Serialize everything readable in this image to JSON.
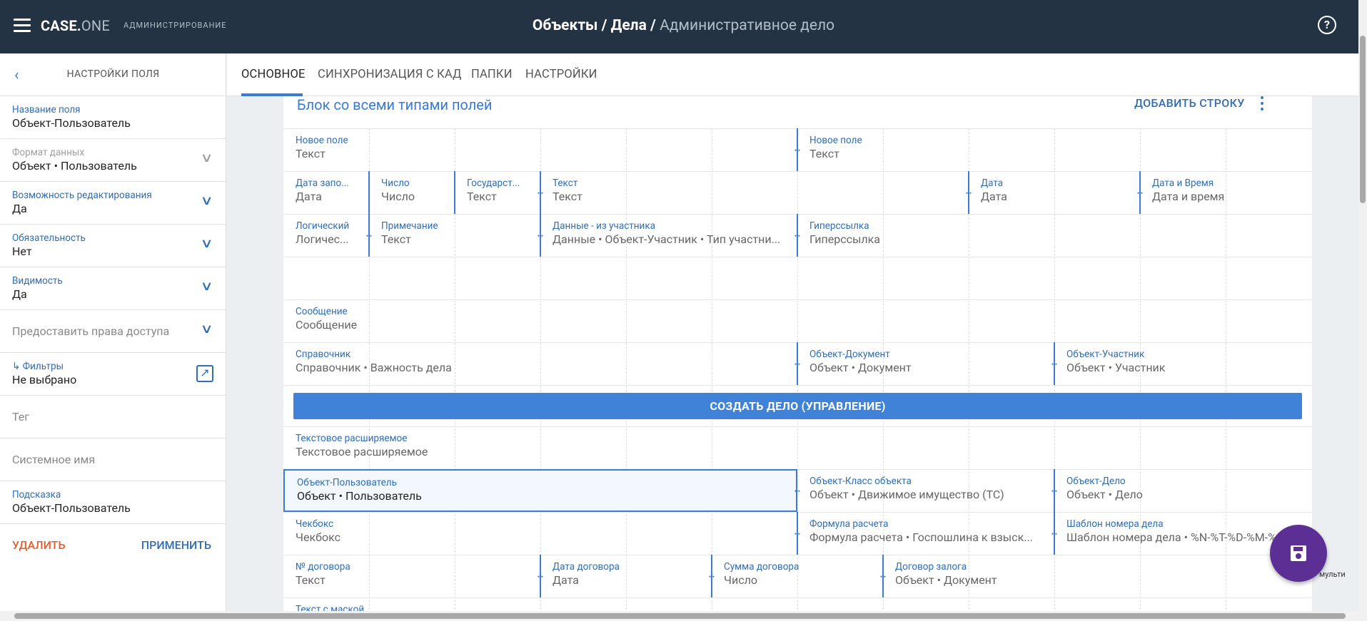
{
  "app": {
    "logo_main": "CASE.",
    "logo_suffix": "ONE",
    "section": "АДМИНИСТРИРОВАНИЕ",
    "breadcrumb": {
      "part1": "Объекты",
      "sep": "/",
      "part2": "Дела",
      "current": "Административное дело"
    },
    "help": "?"
  },
  "sidebar": {
    "title": "НАСТРОЙКИ ПОЛЯ",
    "props": [
      {
        "label": "Название поля",
        "value": "Объект-Пользователь"
      },
      {
        "label": "Формат данных",
        "value": "Объект • Пользователь"
      },
      {
        "label": "Возможность редактирования",
        "value": "Да"
      },
      {
        "label": "Обязательность",
        "value": "Нет"
      },
      {
        "label": "Видимость",
        "value": "Да"
      },
      {
        "label": "Предоставить права доступа"
      },
      {
        "label": "Фильтры",
        "value": "Не выбрано",
        "prefix": "↳"
      },
      {
        "label": "Тег"
      },
      {
        "label": "Системное имя"
      },
      {
        "label": "Подсказка",
        "value": "Объект-Пользователь"
      }
    ],
    "delete": "УДАЛИТЬ",
    "apply": "ПРИМЕНИТЬ"
  },
  "tabs": [
    "ОСНОВНОЕ",
    "СИНХРОНИЗАЦИЯ С КАД",
    "ПАПКИ",
    "НАСТРОЙКИ"
  ],
  "block": {
    "title": "Блок со всеми типами полей",
    "add_row": "ДОБАВИТЬ СТРОКУ",
    "fields": [
      {
        "label": "Новое поле",
        "value": "Текст"
      },
      {
        "label": "Новое поле",
        "value": "Текст"
      },
      {
        "label": "Дата запо...",
        "value": "Дата"
      },
      {
        "label": "Число",
        "value": "Число"
      },
      {
        "label": "Государст...",
        "value": "Текст"
      },
      {
        "label": "Текст",
        "value": "Текст"
      },
      {
        "label": "Дата",
        "value": "Дата"
      },
      {
        "label": "Дата и Время",
        "value": "Дата и время"
      },
      {
        "label": "Логический",
        "value": "Логичес..."
      },
      {
        "label": "Примечание",
        "value": "Текст"
      },
      {
        "label": "Данные - из участника",
        "value": "Данные • Объект-Участник • Тип участни..."
      },
      {
        "label": "Гиперссылка",
        "value": "Гиперссылка"
      },
      {
        "label": "Сообщение",
        "value": "Сообщение"
      },
      {
        "label": "Справочник",
        "value": "Справочник • Важность дела"
      },
      {
        "label": "Объект-Документ",
        "value": "Объект • Документ"
      },
      {
        "label": "Объект-Участник",
        "value": "Объект • Участник"
      },
      {
        "label": "Текстовое расширяемое",
        "value": "Текстовое расширяемое"
      },
      {
        "label": "Объект-Пользователь",
        "value": "Объект • Пользователь"
      },
      {
        "label": "Объект-Класс объекта",
        "value": "Объект • Движимое имущество (ТС)"
      },
      {
        "label": "Объект-Дело",
        "value": "Объект • Дело"
      },
      {
        "label": "Чекбокс",
        "value": "Чекбокс"
      },
      {
        "label": "Формула расчета",
        "value": "Формула расчета • Госпошлина к взыск..."
      },
      {
        "label": "Шаблон номера дела",
        "value": "Шаблон номера дела • %N-%T-%D-%M-%"
      },
      {
        "label": "№ договора",
        "value": "Текст"
      },
      {
        "label": "Дата договора",
        "value": "Дата"
      },
      {
        "label": "Сумма договора",
        "value": "Число"
      },
      {
        "label": "Договор залога",
        "value": "Объект • Документ"
      },
      {
        "label": "Текст с маской",
        "value": ""
      }
    ],
    "create_button": "СОЗДАТЬ ДЕЛО (УПРАВЛЕНИЕ)"
  },
  "fab_hint": "мульти",
  "colors": {
    "topbar": "#243343",
    "accent": "#3a7bd5",
    "danger": "#e25c2d",
    "fab": "#5b2f94"
  }
}
